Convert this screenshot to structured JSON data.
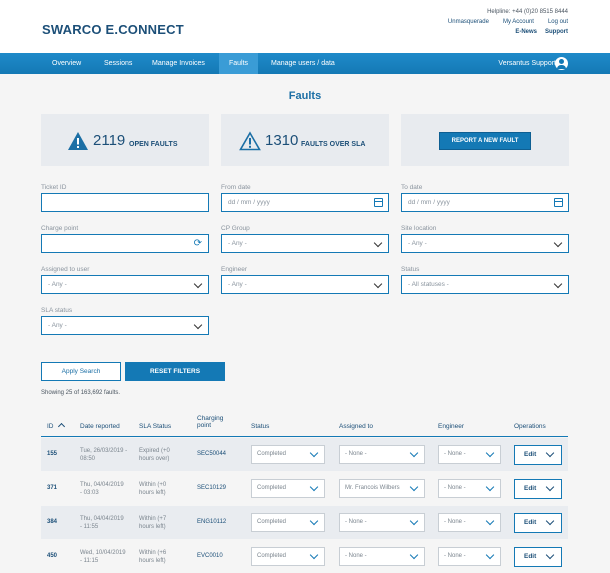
{
  "header": {
    "logo": "SWARCO E.CONNECT",
    "helpline": "Helpline: +44 (0)20 8515 8444",
    "links": [
      "Unmasquerade",
      "My Account",
      "Log out"
    ],
    "links2": [
      "E-News",
      "Support"
    ]
  },
  "nav": {
    "items": [
      "Overview",
      "Sessions",
      "Manage Invoices",
      "Faults",
      "Manage users / data"
    ],
    "active": "Faults",
    "user": "Versantus Support"
  },
  "page": {
    "title": "Faults"
  },
  "stats": {
    "open_count": "2119",
    "open_label": "OPEN FAULTS",
    "sla_count": "1310",
    "sla_label": "FAULTS OVER SLA",
    "report_button": "REPORT A NEW FAULT"
  },
  "filters": {
    "ticket_id": {
      "label": "Ticket ID",
      "value": ""
    },
    "from_date": {
      "label": "From date",
      "placeholder": "dd / mm / yyyy"
    },
    "to_date": {
      "label": "To date",
      "placeholder": "dd / mm / yyyy"
    },
    "charge_point": {
      "label": "Charge point",
      "value": ""
    },
    "cp_group": {
      "label": "CP Group",
      "value": "- Any -"
    },
    "site_location": {
      "label": "Site location",
      "value": "- Any -"
    },
    "assigned_to": {
      "label": "Assigned to user",
      "value": "- Any -"
    },
    "engineer": {
      "label": "Engineer",
      "value": "- Any -"
    },
    "status": {
      "label": "Status",
      "value": "- All statuses -"
    },
    "sla_status": {
      "label": "SLA status",
      "value": "- Any -"
    },
    "apply_button": "Apply Search",
    "reset_button": "RESET FILTERS"
  },
  "results": {
    "summary": "Showing 25 of 163,692 faults."
  },
  "table": {
    "headers": {
      "id": "ID",
      "date": "Date reported",
      "sla": "SLA Status",
      "cp_line1": "Charging",
      "cp_line2": "point",
      "status": "Status",
      "assigned": "Assigned to",
      "engineer": "Engineer",
      "ops": "Operations"
    },
    "rows": [
      {
        "id": "155",
        "date1": "Tue, 26/03/2019 -",
        "date2": "08:50",
        "sla1": "Expired (+0",
        "sla2": "hours over)",
        "cp": "SEC50044",
        "status": "Completed",
        "assigned": "- None -",
        "engineer": "- None -",
        "edit": "Edit"
      },
      {
        "id": "371",
        "date1": "Thu, 04/04/2019",
        "date2": "- 03:03",
        "sla1": "Within (+0",
        "sla2": "hours left)",
        "cp": "SEC10129",
        "status": "Completed",
        "assigned": "Mr. Francois Wilbers",
        "engineer": "- None -",
        "edit": "Edit"
      },
      {
        "id": "384",
        "date1": "Thu, 04/04/2019",
        "date2": "- 11:55",
        "sla1": "Within (+7",
        "sla2": "hours left)",
        "cp": "ENG10112",
        "status": "Completed",
        "assigned": "- None -",
        "engineer": "- None -",
        "edit": "Edit"
      },
      {
        "id": "450",
        "date1": "Wed, 10/04/2019",
        "date2": "- 11:15",
        "sla1": "Within (+6",
        "sla2": "hours left)",
        "cp": "EVC0010",
        "status": "Completed",
        "assigned": "- None -",
        "engineer": "- None -",
        "edit": "Edit"
      }
    ]
  }
}
